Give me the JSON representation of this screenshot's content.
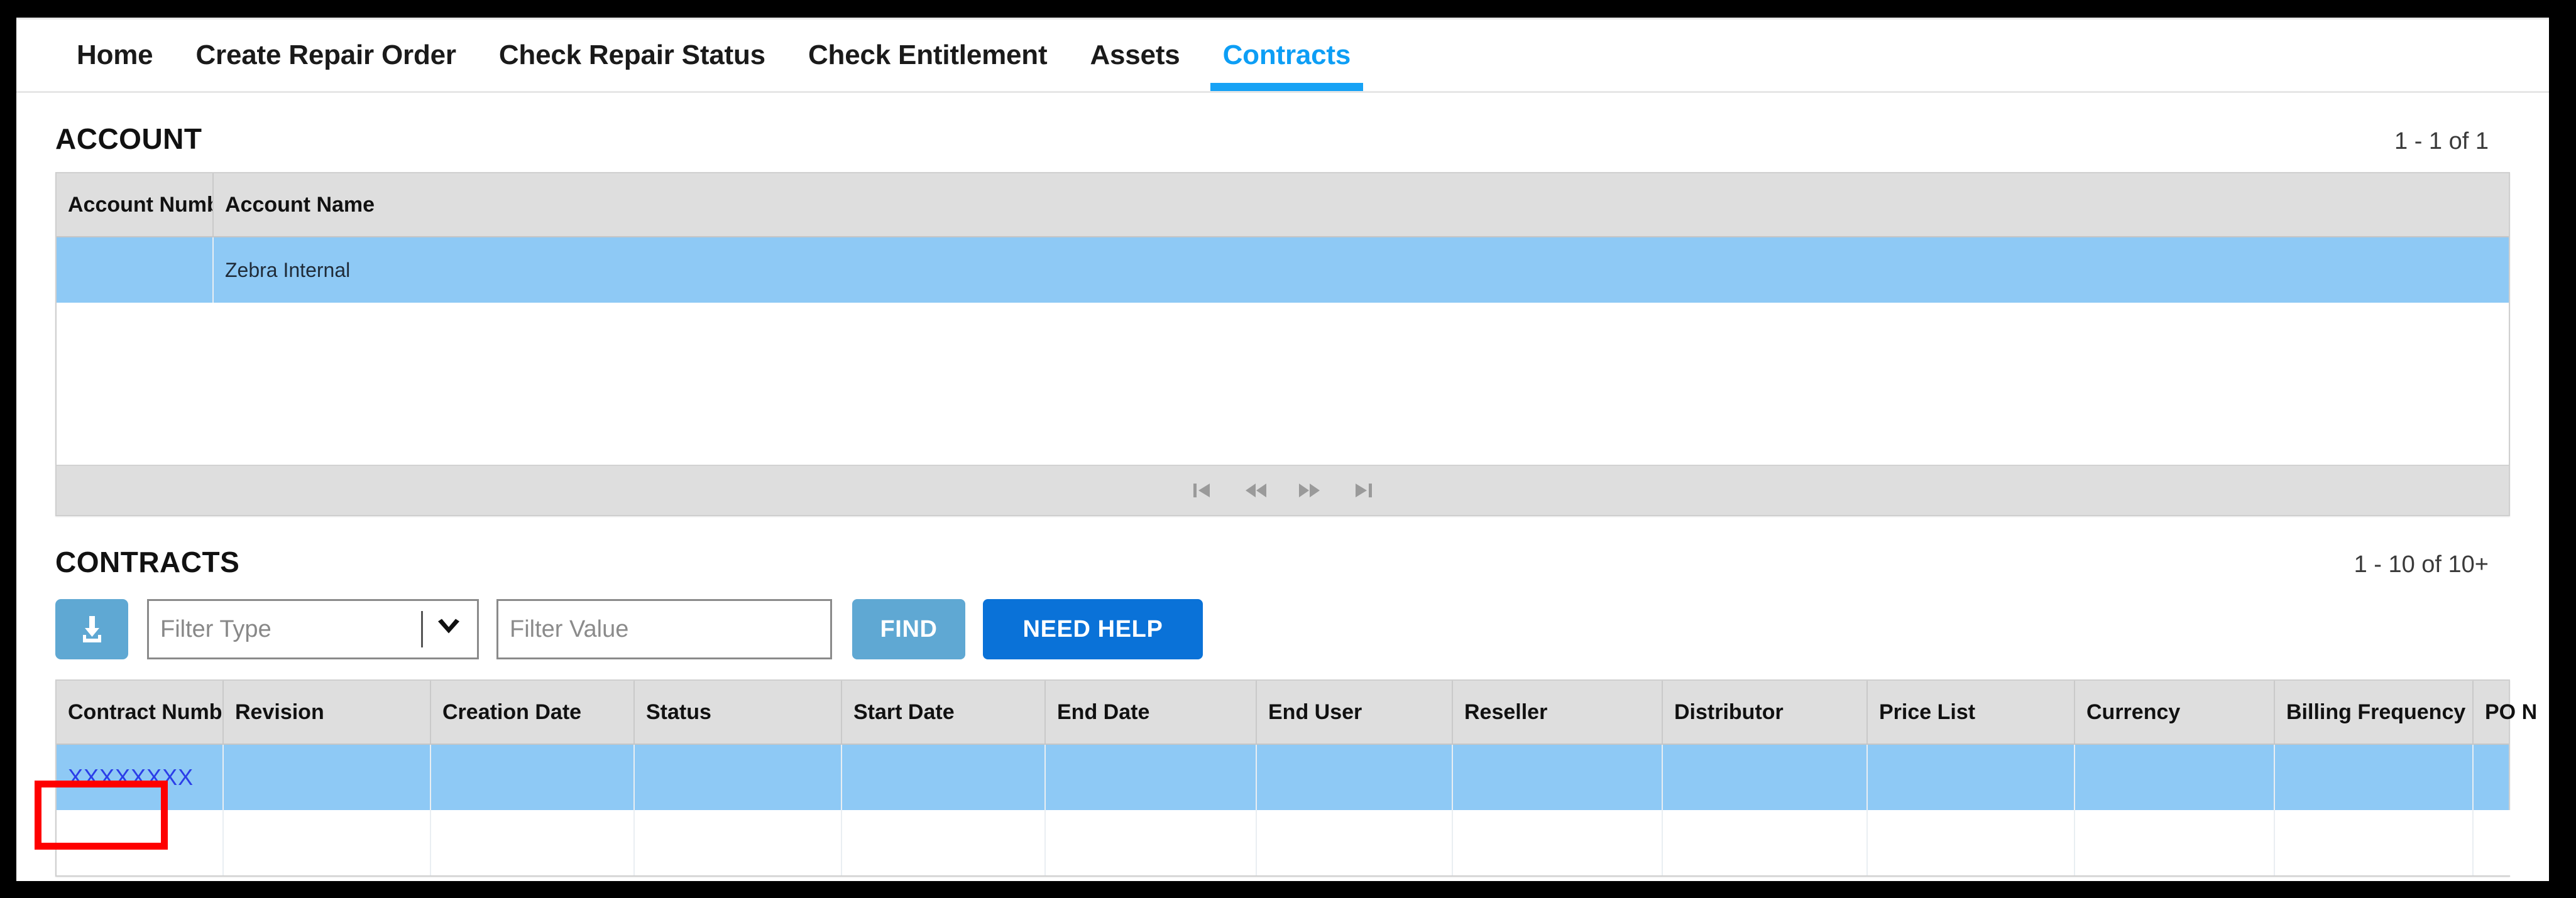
{
  "nav": {
    "tabs": [
      {
        "label": "Home",
        "active": false
      },
      {
        "label": "Create Repair Order",
        "active": false
      },
      {
        "label": "Check Repair Status",
        "active": false
      },
      {
        "label": "Check Entitlement",
        "active": false
      },
      {
        "label": "Assets",
        "active": false
      },
      {
        "label": "Contracts",
        "active": true
      }
    ],
    "active_tab": "Contracts",
    "active_color": "#0d9ef5"
  },
  "account": {
    "title": "ACCOUNT",
    "count": "1 - 1 of 1",
    "columns": [
      "Account Number",
      "Account Name"
    ],
    "rows": [
      {
        "account_number": "",
        "account_name": "Zebra Internal",
        "selected": true
      }
    ],
    "pager": {
      "first": "first-page",
      "prev": "previous-page",
      "next": "next-page",
      "last": "last-page"
    }
  },
  "contracts": {
    "title": "CONTRACTS",
    "count": "1 - 10 of 10+",
    "toolbar": {
      "download_icon": "download-icon",
      "filter_type_placeholder": "Filter Type",
      "filter_type_value": "",
      "filter_value_placeholder": "Filter Value",
      "filter_value_value": "",
      "find_label": "FIND",
      "help_label": "NEED HELP"
    },
    "columns": [
      "Contract Number",
      "Revision",
      "Creation Date",
      "Status",
      "Start Date",
      "End Date",
      "End User",
      "Reseller",
      "Distributor",
      "Price List",
      "Currency",
      "Billing Frequency",
      "PO N"
    ],
    "rows": [
      {
        "contract_number": "XXXXXXXX",
        "revision": "",
        "creation_date": "",
        "status": "",
        "start_date": "",
        "end_date": "",
        "end_user": "",
        "reseller": "",
        "distributor": "",
        "price_list": "",
        "currency": "",
        "billing_frequency": "",
        "po_number": "",
        "selected": true
      },
      {
        "contract_number": "",
        "revision": "",
        "creation_date": "",
        "status": "",
        "start_date": "",
        "end_date": "",
        "end_user": "",
        "reseller": "",
        "distributor": "",
        "price_list": "",
        "currency": "",
        "billing_frequency": "",
        "po_number": "",
        "selected": false
      }
    ]
  },
  "annotation": {
    "type": "highlight-box",
    "color": "#fe0000",
    "target": "contract-number-link"
  },
  "colors": {
    "selected_row": "#8ec9f5",
    "header_grey": "#dedede",
    "accent_blue": "#0d9ef5",
    "button_light_blue": "#5fa8d3",
    "button_blue": "#0a72d8",
    "link_blue": "#2b3ee8",
    "annotation_red": "#fe0000"
  }
}
